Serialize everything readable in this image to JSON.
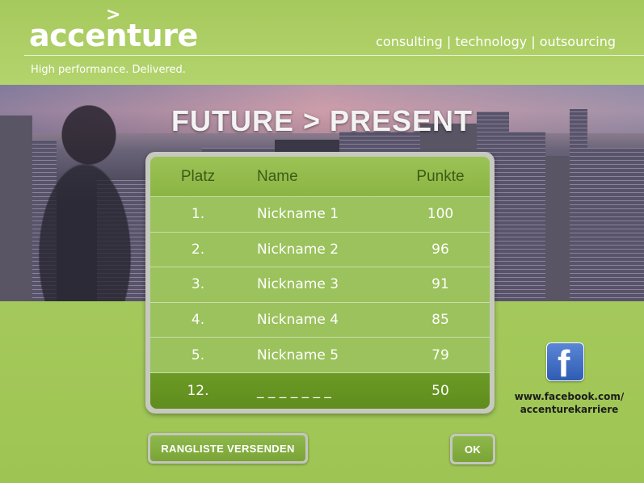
{
  "header": {
    "logo_text": "accenture",
    "logo_mark": ">",
    "tagline": "consulting | technology | outsourcing",
    "slogan": "High performance. Delivered."
  },
  "banner": {
    "title": "FUTURE > PRESENT"
  },
  "table": {
    "columns": [
      "Platz",
      "Name",
      "Punkte"
    ],
    "rows": [
      {
        "rank": "1.",
        "name": "Nickname 1",
        "score": "100"
      },
      {
        "rank": "2.",
        "name": "Nickname 2",
        "score": "96"
      },
      {
        "rank": "3.",
        "name": "Nickname 3",
        "score": "91"
      },
      {
        "rank": "4.",
        "name": "Nickname 4",
        "score": "85"
      },
      {
        "rank": "5.",
        "name": "Nickname 5",
        "score": "79"
      }
    ],
    "user_row": {
      "rank": "12.",
      "name": "_ _ _ _ _ _ _",
      "score": "50"
    }
  },
  "facebook": {
    "icon": "facebook-icon",
    "url_line1": "www.facebook.com/",
    "url_line2": "accenturekarriere"
  },
  "buttons": {
    "send_label": "RANGLISTE VERSENDEN",
    "ok_label": "OK"
  },
  "colors": {
    "brand_green": "#a6c95d",
    "table_green": "#9bc25c",
    "highlight_green": "#6c9a25",
    "facebook_blue": "#3b5998"
  }
}
